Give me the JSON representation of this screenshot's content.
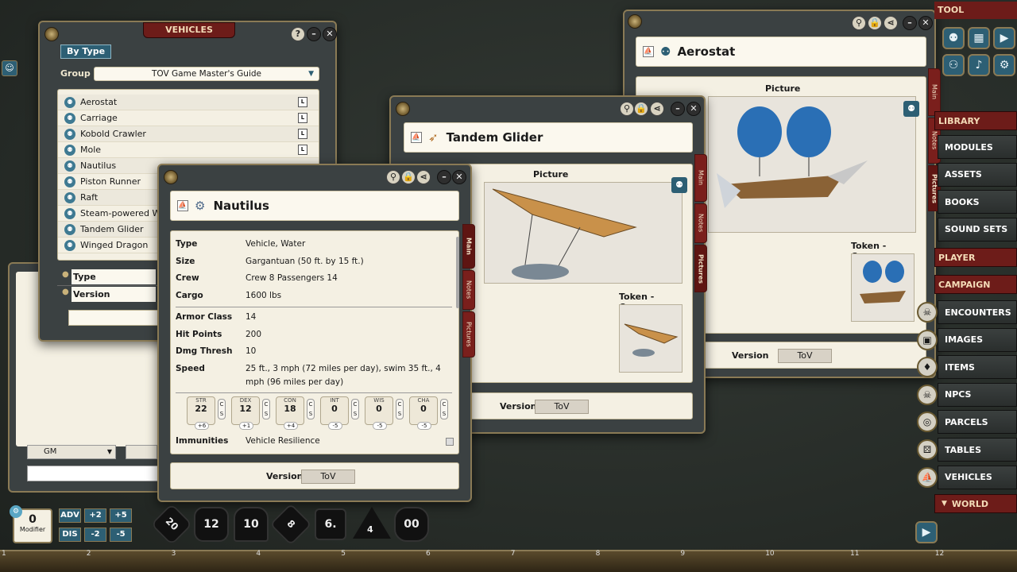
{
  "vehicles_window": {
    "title": "VEHICLES",
    "filter_button": "By Type",
    "group_label": "Group",
    "group_value": "TOV Game Master's Guide",
    "items": [
      "Aerostat",
      "Carriage",
      "Kobold Crawler",
      "Mole",
      "Nautilus",
      "Piston Runner",
      "Raft",
      "Steam-powered War",
      "Tandem Glider",
      "Winged Dragon"
    ],
    "item_tag": "L",
    "filter_rows": [
      "Type",
      "Version"
    ]
  },
  "aerostat_window": {
    "name": "Aerostat",
    "picture_label": "Picture",
    "token_label": "Token - Camera",
    "version_label": "Version",
    "version_value": "ToV"
  },
  "glider_window": {
    "name": "Tandem Glider",
    "picture_label": "Picture",
    "token_label": "Token - Camera",
    "version_label": "Version",
    "version_value": "ToV"
  },
  "nautilus_window": {
    "name": "Nautilus",
    "fields": [
      {
        "k": "Type",
        "v": "Vehicle, Water"
      },
      {
        "k": "Size",
        "v": "Gargantuan (50 ft. by 15 ft.)"
      },
      {
        "k": "Crew",
        "v": "Crew 8 Passengers 14"
      },
      {
        "k": "Cargo",
        "v": "1600 lbs"
      }
    ],
    "combat": [
      {
        "k": "Armor Class",
        "v": "14"
      },
      {
        "k": "Hit Points",
        "v": "200"
      },
      {
        "k": "Dmg Thresh",
        "v": "10"
      }
    ],
    "speed_label": "Speed",
    "speed_value": "25 ft., 3 mph (72 miles per day), swim 35 ft., 4 mph (96 miles per day)",
    "stats": [
      {
        "n": "STR",
        "v": "22",
        "m": "+6"
      },
      {
        "n": "DEX",
        "v": "12",
        "m": "+1"
      },
      {
        "n": "CON",
        "v": "18",
        "m": "+4"
      },
      {
        "n": "INT",
        "v": "0",
        "m": "-5"
      },
      {
        "n": "WIS",
        "v": "0",
        "m": "-5"
      },
      {
        "n": "CHA",
        "v": "0",
        "m": "-5"
      }
    ],
    "immunities_label": "Immunities",
    "immunities_value": "Vehicle Resilience",
    "version_label": "Version",
    "version_value": "ToV"
  },
  "tabs": {
    "main": "Main",
    "notes": "Notes",
    "pictures": "Pictures"
  },
  "chat": {
    "identity": "GM"
  },
  "modifier": {
    "value": "0",
    "label": "Modifier",
    "adv": "ADV",
    "dis": "DIS",
    "p2": "+2",
    "p5": "+5",
    "m2": "-2",
    "m5": "-5"
  },
  "dice": [
    "20",
    "12",
    "10",
    "8",
    "6.",
    "4",
    "00"
  ],
  "sidebar": {
    "tool": "TOOL",
    "library": "LIBRARY",
    "library_items": [
      "MODULES",
      "ASSETS",
      "BOOKS",
      "SOUND SETS"
    ],
    "player": "PLAYER",
    "campaign": "CAMPAIGN",
    "campaign_items": [
      "ENCOUNTERS",
      "IMAGES",
      "ITEMS",
      "NPCS",
      "PARCELS",
      "TABLES",
      "VEHICLES"
    ],
    "world": "WORLD"
  },
  "hotbar": [
    "1",
    "2",
    "3",
    "4",
    "5",
    "6",
    "7",
    "8",
    "9",
    "10",
    "11",
    "12"
  ]
}
